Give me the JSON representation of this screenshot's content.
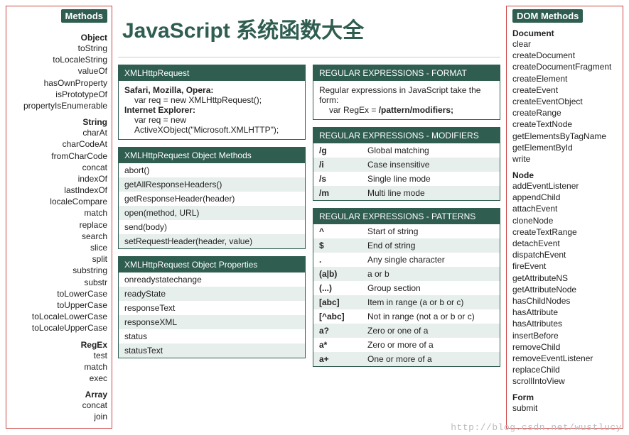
{
  "page_title": "JavaScript 系统函数大全",
  "watermark": "http://blog.csdn.net/wustlucy",
  "left": {
    "header": "Methods",
    "groups": [
      {
        "title": "Object",
        "items": [
          "toString",
          "toLocaleString",
          "valueOf",
          "hasOwnProperty",
          "isPrototypeOf",
          "propertyIsEnumerable"
        ]
      },
      {
        "title": "String",
        "items": [
          "charAt",
          "charCodeAt",
          "fromCharCode",
          "concat",
          "indexOf",
          "lastIndexOf",
          "localeCompare",
          "match",
          "replace",
          "search",
          "slice",
          "split",
          "substring",
          "substr",
          "toLowerCase",
          "toUpperCase",
          "toLocaleLowerCase",
          "toLocaleUpperCase"
        ]
      },
      {
        "title": "RegEx",
        "items": [
          "test",
          "match",
          "exec"
        ]
      },
      {
        "title": "Array",
        "items": [
          "concat",
          "join"
        ]
      }
    ]
  },
  "right": {
    "header": "DOM Methods",
    "groups": [
      {
        "title": "Document",
        "items": [
          "clear",
          "createDocument",
          "createDocumentFragment",
          "createElement",
          "createEvent",
          "createEventObject",
          "createRange",
          "createTextNode",
          "getElementsByTagName",
          "getElementById",
          "write"
        ]
      },
      {
        "title": "Node",
        "items": [
          "addEventListener",
          "appendChild",
          "attachEvent",
          "cloneNode",
          "createTextRange",
          "detachEvent",
          "dispatchEvent",
          "fireEvent",
          "getAttributeNS",
          "getAttributeNode",
          "hasChildNodes",
          "hasAttribute",
          "hasAttributes",
          "insertBefore",
          "removeChild",
          "removeEventListener",
          "replaceChild",
          "scrollIntoView"
        ]
      },
      {
        "title": "Form",
        "items": [
          "submit"
        ]
      }
    ]
  },
  "center": {
    "left": {
      "xhr_title": "XMLHttpRequest",
      "xhr_body": {
        "l1b": "Safari, Mozilla, Opera:",
        "l2": "var req = new XMLHttpRequest();",
        "l3b": "Internet Explorer:",
        "l4": "var req = new",
        "l5": "ActiveXObject(\"Microsoft.XMLHTTP\");"
      },
      "xhr_methods_title": "XMLHttpRequest Object Methods",
      "xhr_methods": [
        "abort()",
        "getAllResponseHeaders()",
        "getResponseHeader(header)",
        "open(method, URL)",
        "send(body)",
        "setRequestHeader(header, value)"
      ],
      "xhr_props_title": "XMLHttpRequest Object Properties",
      "xhr_props": [
        "onreadystatechange",
        "readyState",
        "responseText",
        "responseXML",
        "status",
        "statusText"
      ]
    },
    "right": {
      "re_format_title": "REGULAR EXPRESSIONS - FORMAT",
      "re_format_body": {
        "l1": "Regular expressions in JavaScript take the form:",
        "l2a": "var RegEx = ",
        "l2b": "/pattern/modifiers;"
      },
      "re_mod_title": "REGULAR EXPRESSIONS - MODIFIERS",
      "re_mods": [
        {
          "k": "/g",
          "v": "Global matching"
        },
        {
          "k": "/i",
          "v": "Case insensitive"
        },
        {
          "k": "/s",
          "v": "Single line mode"
        },
        {
          "k": "/m",
          "v": "Multi line mode"
        }
      ],
      "re_pat_title": "REGULAR EXPRESSIONS - PATTERNS",
      "re_pats": [
        {
          "k": "^",
          "v": "Start of string"
        },
        {
          "k": "$",
          "v": "End of string"
        },
        {
          "k": ".",
          "v": "Any single character"
        },
        {
          "k": "(a|b)",
          "v": "a or b"
        },
        {
          "k": "(...)",
          "v": "Group section"
        },
        {
          "k": "[abc]",
          "v": "Item in range (a or b or c)"
        },
        {
          "k": "[^abc]",
          "v": "Not in range (not a or b or c)"
        },
        {
          "k": "a?",
          "v": "Zero or one of a"
        },
        {
          "k": "a*",
          "v": "Zero or more of a"
        },
        {
          "k": "a+",
          "v": "One or more of a"
        }
      ]
    }
  }
}
